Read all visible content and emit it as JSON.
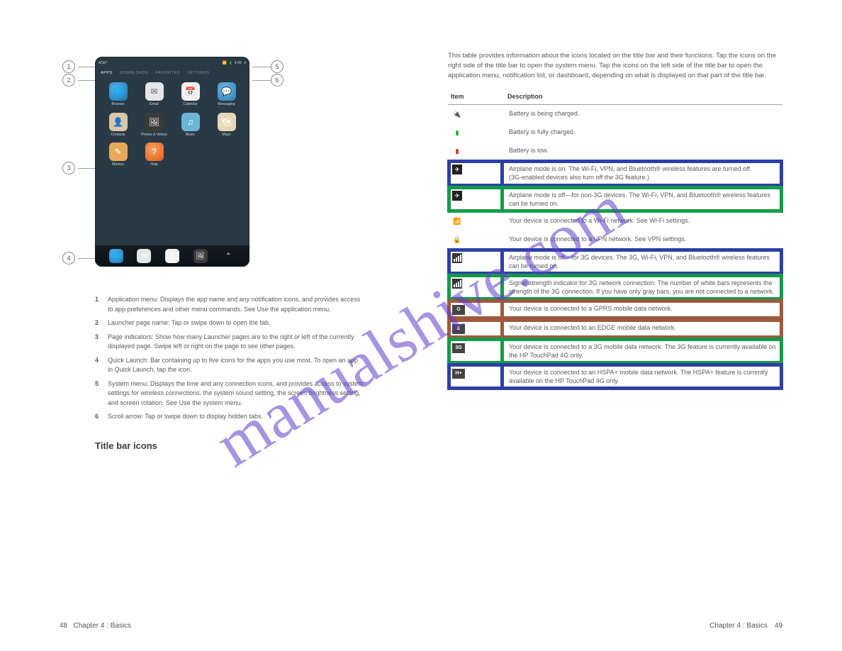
{
  "watermark": "manualshive.com",
  "page_left_number": "48",
  "page_left_chapter": "Chapter 4 : Basics",
  "page_right_chapter": "Chapter 4 : Basics",
  "page_right_number": "49",
  "device": {
    "status_carrier": "AT&T",
    "status_time": "4:30",
    "tabs": [
      "APPS",
      "DOWNLOADS",
      "FAVORITES",
      "SETTINGS"
    ],
    "apps": [
      {
        "label": "Browser",
        "icon": "browser-icon",
        "cls": "ic-browser",
        "glyph": "🌐"
      },
      {
        "label": "Email",
        "icon": "email-icon",
        "cls": "ic-email",
        "glyph": "✉"
      },
      {
        "label": "Calendar",
        "icon": "calendar-icon",
        "cls": "ic-cal",
        "glyph": "📅"
      },
      {
        "label": "Messaging",
        "icon": "messaging-icon",
        "cls": "ic-msg",
        "glyph": "💬"
      },
      {
        "label": "Contacts",
        "icon": "contacts-icon",
        "cls": "ic-contacts",
        "glyph": "👤"
      },
      {
        "label": "Photos & Videos",
        "icon": "photos-icon",
        "cls": "ic-photos",
        "glyph": "🖼"
      },
      {
        "label": "Music",
        "icon": "music-icon",
        "cls": "ic-music",
        "glyph": "♫"
      },
      {
        "label": "Maps",
        "icon": "maps-icon",
        "cls": "ic-maps",
        "glyph": "🗺"
      },
      {
        "label": "Memos",
        "icon": "memos-icon",
        "cls": "ic-memos",
        "glyph": "✎"
      },
      {
        "label": "Help",
        "icon": "help-icon",
        "cls": "ic-help",
        "glyph": "?"
      }
    ],
    "dock": [
      {
        "icon": "browser-icon",
        "cls": "ic-browser",
        "glyph": "🌐"
      },
      {
        "icon": "email-icon",
        "cls": "ic-email",
        "glyph": "✉"
      },
      {
        "icon": "calendar-icon",
        "cls": "ic-cal",
        "glyph": "5"
      },
      {
        "icon": "photos-icon",
        "cls": "ic-photos",
        "glyph": "🖼"
      },
      {
        "icon": "up-icon",
        "cls": "",
        "glyph": "⌃"
      }
    ]
  },
  "legend": [
    {
      "n": "1",
      "t": "Application menu: Displays the app name and any notification icons, and provides access to app preferences and other menu commands. See Use the application menu."
    },
    {
      "n": "2",
      "t": "Launcher page name: Tap or swipe down to open the tab."
    },
    {
      "n": "3",
      "t": "Page indicators: Show how many Launcher pages are to the right or left of the currently displayed page. Swipe left or right on the page to see other pages."
    },
    {
      "n": "4",
      "t": "Quick Launch: Bar containing up to five icons for the apps you use most. To open an app in Quick Launch, tap the icon."
    },
    {
      "n": "5",
      "t": "System menu: Displays the time and any connection icons, and provides access to system settings for wireless connections, the system sound setting, the screen brightness setting, and screen rotation. See Use the system menu."
    },
    {
      "n": "6",
      "t": "Scroll arrow: Tap or swipe down to display hidden tabs."
    }
  ],
  "section_title": "Title bar icons",
  "right_intro": "This table provides information about the icons located on the title bar and their functions. Tap the icons on the right side of the title bar to open the system menu. Tap the icons on the left side of the title bar to open the application menu, notification list, or dashboard, depending on what is displayed on that part of the title bar.",
  "table": {
    "headers": [
      "Item",
      "Description"
    ],
    "rows": [
      {
        "icon": "battery-charging-icon",
        "glyph": "🔌",
        "desc": "Battery is being charged."
      },
      {
        "icon": "battery-full-icon",
        "glyph": "▮",
        "color": "#1aa81a",
        "desc": "Battery is fully charged."
      },
      {
        "icon": "battery-low-icon",
        "glyph": "▮",
        "color": "#c22",
        "desc": "Battery is low."
      },
      {
        "icon": "airplane-on-icon",
        "glyph": "✈",
        "desc": "Airplane mode is on. The Wi‑Fi, VPN, and Bluetooth® wireless features are turned off. (3G‑enabled devices also turn off the 3G feature.)",
        "frame": "blue"
      },
      {
        "icon": "airplane-off-icon",
        "glyph": "✈",
        "desc": "Airplane mode is off—for non‑3G devices. The Wi‑Fi, VPN, and Bluetooth® wireless features can be turned on.",
        "frame": "green"
      },
      {
        "icon": "wifi-icon",
        "glyph": "📶",
        "desc": "Your device is connected to a Wi‑Fi network. See Wi‑Fi settings."
      },
      {
        "icon": "vpn-icon",
        "glyph": "🔒",
        "desc": "Your device is connected to a VPN network. See VPN settings."
      },
      {
        "icon": "signal-on-icon",
        "glyph": "▮",
        "desc": "Airplane mode is off—for 3G devices. The 3G, Wi‑Fi, VPN, and Bluetooth® wireless features can be turned on.",
        "frame": "blue"
      },
      {
        "icon": "signal-strength-icon",
        "glyph": "▮",
        "desc": "Signal‑strength indicator for 3G network connection: The number of white bars represents the strength of the 3G connection. If you have only gray bars, you are not connected to a network.",
        "frame": "green"
      },
      {
        "icon": "gprs-icon",
        "glyph": "G",
        "desc": "Your device is connected to a GPRS mobile data network.",
        "frame": "brown"
      },
      {
        "icon": "edge-icon",
        "glyph": "E",
        "desc": "Your device is connected to an EDGE mobile data network.",
        "frame": "brown"
      },
      {
        "icon": "3g-icon",
        "glyph": "3G",
        "desc": "Your device is connected to a 3G mobile data network. The 3G feature is currently available on the HP TouchPad 4G only.",
        "frame": "green"
      },
      {
        "icon": "hplus-icon",
        "glyph": "H+",
        "desc": "Your device is connected to an HSPA+ mobile data network. The HSPA+ feature is currently available on the HP TouchPad 4G only.",
        "frame": "blue"
      }
    ]
  }
}
